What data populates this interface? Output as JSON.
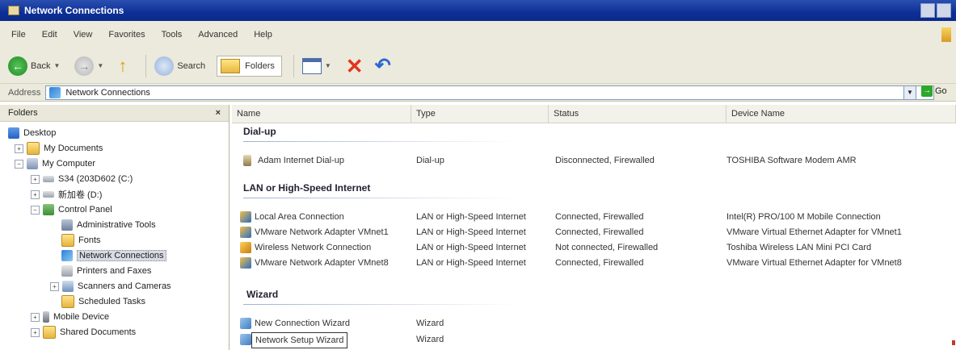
{
  "window": {
    "title": "Network Connections"
  },
  "menu": [
    "File",
    "Edit",
    "View",
    "Favorites",
    "Tools",
    "Advanced",
    "Help"
  ],
  "toolbar": {
    "back_label": "Back",
    "search_label": "Search",
    "folders_label": "Folders",
    "icons": [
      "back-icon",
      "forward-icon",
      "up-icon",
      "search-icon",
      "folders-icon",
      "views-icon",
      "delete-icon",
      "undo-icon"
    ]
  },
  "address": {
    "label": "Address",
    "value": "Network Connections",
    "go_label": "Go"
  },
  "folders_pane": {
    "title": "Folders",
    "close": "×",
    "tree": [
      {
        "label": "Desktop",
        "icon": "desktop-icon"
      },
      {
        "label": "My Documents",
        "icon": "folder-icon"
      },
      {
        "label": "My Computer",
        "icon": "computer-icon"
      },
      {
        "label": "S34 (203D602 (C:)",
        "icon": "drive-icon"
      },
      {
        "label": "新加卷 (D:)",
        "icon": "drive-icon"
      },
      {
        "label": "Control Panel",
        "icon": "control-panel-icon"
      },
      {
        "label": "Administrative Tools",
        "icon": "admin-tools-icon"
      },
      {
        "label": "Fonts",
        "icon": "fonts-icon"
      },
      {
        "label": "Network Connections",
        "icon": "network-icon"
      },
      {
        "label": "Printers and Faxes",
        "icon": "printer-icon"
      },
      {
        "label": "Scanners and Cameras",
        "icon": "scanner-icon"
      },
      {
        "label": "Scheduled Tasks",
        "icon": "tasks-icon"
      },
      {
        "label": "Mobile Device",
        "icon": "mobile-icon"
      },
      {
        "label": "Shared Documents",
        "icon": "folder-icon"
      }
    ]
  },
  "columns": [
    "Name",
    "Type",
    "Status",
    "Device Name"
  ],
  "groups": {
    "dialup": "Dial-up",
    "lan": "LAN or High-Speed Internet",
    "wizard": "Wizard"
  },
  "rows": {
    "dialup": [
      {
        "name": "Adam Internet Dial-up",
        "type": "Dial-up",
        "status": "Disconnected, Firewalled",
        "device": "TOSHIBA Software Modem AMR"
      }
    ],
    "lan": [
      {
        "name": "Local Area Connection",
        "type": "LAN or High-Speed Internet",
        "status": "Connected, Firewalled",
        "device": "Intel(R) PRO/100 M Mobile Connection"
      },
      {
        "name": "VMware Network Adapter VMnet1",
        "type": "LAN or High-Speed Internet",
        "status": "Connected, Firewalled",
        "device": "VMware Virtual Ethernet Adapter for VMnet1"
      },
      {
        "name": "Wireless Network Connection",
        "type": "LAN or High-Speed Internet",
        "status": "Not connected, Firewalled",
        "device": "Toshiba Wireless LAN Mini PCI Card"
      },
      {
        "name": "VMware Network Adapter VMnet8",
        "type": "LAN or High-Speed Internet",
        "status": "Connected, Firewalled",
        "device": "VMware Virtual Ethernet Adapter for VMnet8"
      }
    ],
    "wizard": [
      {
        "name": "New Connection Wizard",
        "type": "Wizard"
      },
      {
        "name": "Network Setup Wizard",
        "type": "Wizard"
      }
    ]
  }
}
